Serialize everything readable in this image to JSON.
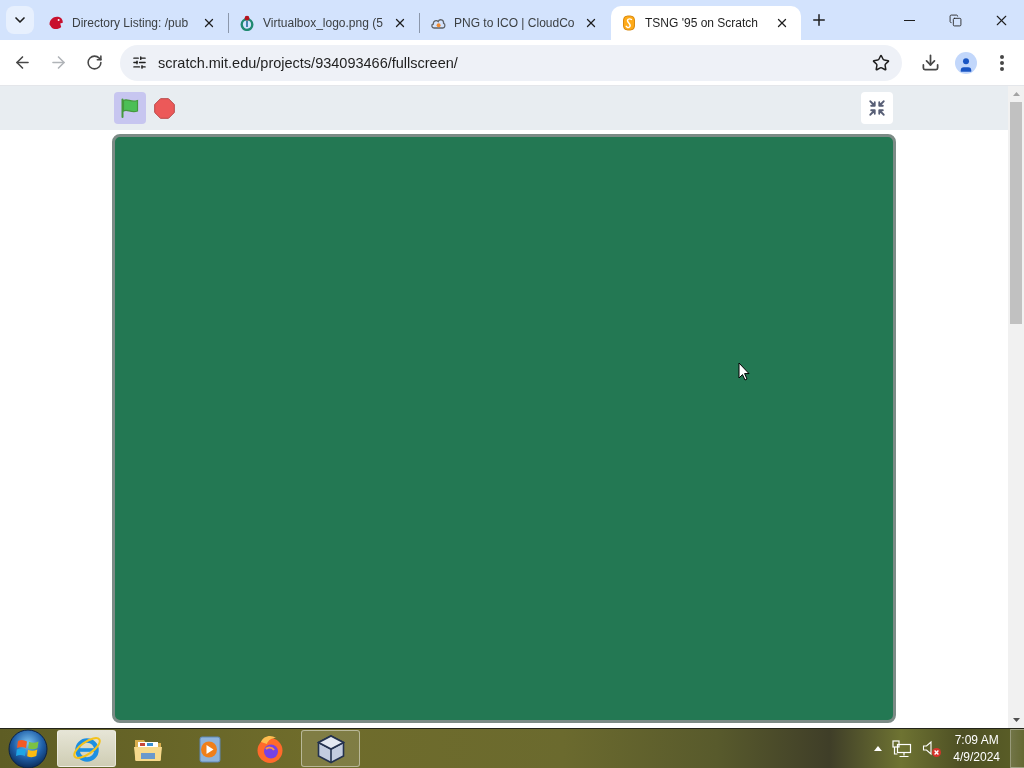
{
  "browser": {
    "tabs": [
      {
        "kind": "animal",
        "title": "Directory Listing: /pub",
        "selected": false
      },
      {
        "kind": "ring",
        "title": "Virtualbox_logo.png (5",
        "selected": false
      },
      {
        "kind": "cloud",
        "title": "PNG to ICO | CloudCo",
        "selected": false
      },
      {
        "kind": "squiggle",
        "title": "TSNG '95 on Scratch",
        "selected": true
      }
    ],
    "address": "scratch.mit.edu/projects/934093466/fullscreen/"
  },
  "player": {
    "flag_active": true
  },
  "taskbar": {
    "apps": [
      {
        "kind": "ie",
        "running": true,
        "selected": true
      },
      {
        "kind": "folder",
        "running": false,
        "selected": false
      },
      {
        "kind": "media",
        "running": false,
        "selected": false
      },
      {
        "kind": "firefox",
        "running": false,
        "selected": false
      },
      {
        "kind": "cube",
        "running": true,
        "selected": false
      }
    ],
    "tray": {
      "muted": true
    },
    "time": "7:09 AM",
    "date": "4/9/2024"
  }
}
